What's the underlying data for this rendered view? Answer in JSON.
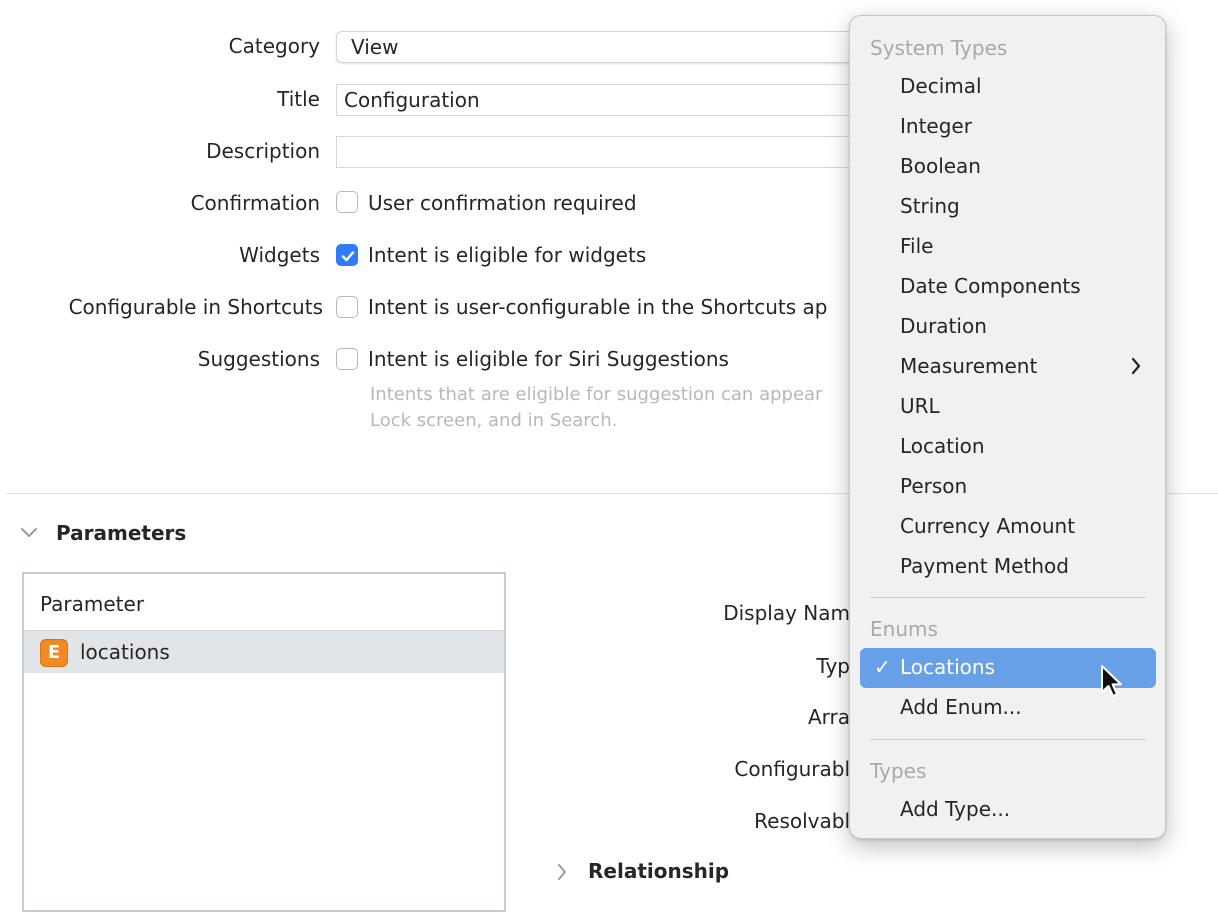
{
  "form": {
    "category_label": "Category",
    "category_value": "View",
    "title_label": "Title",
    "title_value": "Configuration",
    "description_label": "Description",
    "description_value": "",
    "confirmation_label": "Confirmation",
    "confirmation_text": "User confirmation required",
    "widgets_label": "Widgets",
    "widgets_text": "Intent is eligible for widgets",
    "configurable_label": "Configurable in Shortcuts",
    "configurable_text": "Intent is user-configurable in the Shortcuts ap",
    "suggestions_label": "Suggestions",
    "suggestions_text": "Intent is eligible for Siri Suggestions",
    "help_line1": "Intents that are eligible for suggestion can appear",
    "help_line2": "Lock screen, and in Search."
  },
  "checkboxes": {
    "confirmation": false,
    "widgets": true,
    "configurable": false,
    "suggestions": false
  },
  "parameters": {
    "section_title": "Parameters",
    "table_header": "Parameter",
    "rows": [
      {
        "badge": "E",
        "name": "locations"
      }
    ],
    "detail_labels": {
      "display_name": "Display Nam",
      "type": "Typ",
      "array": "Arra",
      "configurable": "Configurabl",
      "resolvable": "Resolvabl"
    },
    "relationship_title": "Relationship"
  },
  "menu": {
    "system_types_heading": "System Types",
    "system_types": [
      "Decimal",
      "Integer",
      "Boolean",
      "String",
      "File",
      "Date Components",
      "Duration",
      "Measurement",
      "URL",
      "Location",
      "Person",
      "Currency Amount",
      "Payment Method"
    ],
    "enums_heading": "Enums",
    "enums": [
      "Locations",
      "Add Enum..."
    ],
    "selected_enum": "Locations",
    "checkmark": "✓",
    "types_heading": "Types",
    "types": [
      "Add Type..."
    ]
  },
  "colors": {
    "accent": "#2f7cf6",
    "menu_selected": "#68a0e8",
    "enum_badge": "#f08b23",
    "help_text": "#b8b8b8"
  }
}
